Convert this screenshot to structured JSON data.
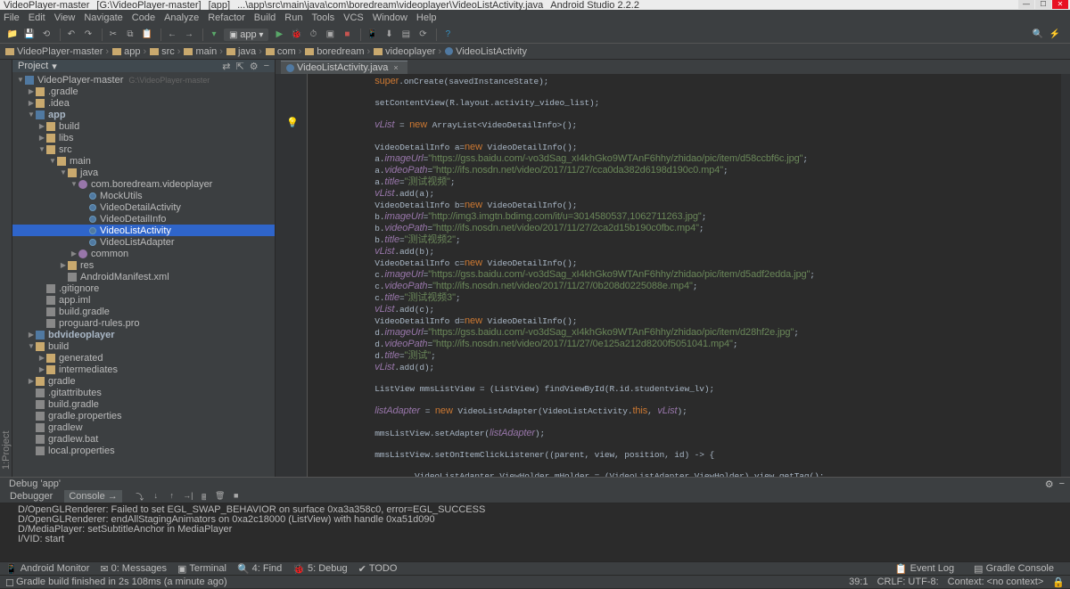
{
  "title": {
    "project": "VideoPlayer-master",
    "path": "[G:\\VideoPlayer-master]",
    "module": "[app]",
    "file": "...\\app\\src\\main\\java\\com\\boredream\\videoplayer\\VideoListActivity.java",
    "ide": "Android Studio 2.2.2"
  },
  "menu": [
    "File",
    "Edit",
    "View",
    "Navigate",
    "Code",
    "Analyze",
    "Refactor",
    "Build",
    "Run",
    "Tools",
    "VCS",
    "Window",
    "Help"
  ],
  "toolbar": {
    "config": "app"
  },
  "breadcrumb": [
    "VideoPlayer-master",
    "app",
    "src",
    "main",
    "java",
    "com",
    "boredream",
    "videoplayer",
    "VideoListActivity"
  ],
  "project_header": "Project",
  "tree": [
    {
      "d": 0,
      "a": "open",
      "i": "module",
      "l": "VideoPlayer-master",
      "p": "G:\\VideoPlayer-master"
    },
    {
      "d": 1,
      "a": "closed",
      "i": "folder",
      "l": ".gradle"
    },
    {
      "d": 1,
      "a": "closed",
      "i": "folder",
      "l": ".idea"
    },
    {
      "d": 1,
      "a": "open",
      "i": "module",
      "l": "app",
      "cls": "mod"
    },
    {
      "d": 2,
      "a": "closed",
      "i": "folder",
      "l": "build"
    },
    {
      "d": 2,
      "a": "closed",
      "i": "folder",
      "l": "libs"
    },
    {
      "d": 2,
      "a": "open",
      "i": "folder",
      "l": "src"
    },
    {
      "d": 3,
      "a": "open",
      "i": "folder",
      "l": "main"
    },
    {
      "d": 4,
      "a": "open",
      "i": "folder",
      "l": "java"
    },
    {
      "d": 5,
      "a": "open",
      "i": "pkg",
      "l": "com.boredream.videoplayer"
    },
    {
      "d": 6,
      "a": "none",
      "i": "class",
      "l": "MockUtils"
    },
    {
      "d": 6,
      "a": "none",
      "i": "class",
      "l": "VideoDetailActivity"
    },
    {
      "d": 6,
      "a": "none",
      "i": "class",
      "l": "VideoDetailInfo"
    },
    {
      "d": 6,
      "a": "none",
      "i": "class",
      "l": "VideoListActivity",
      "sel": true
    },
    {
      "d": 6,
      "a": "none",
      "i": "class",
      "l": "VideoListAdapter"
    },
    {
      "d": 5,
      "a": "closed",
      "i": "pkg",
      "l": "common"
    },
    {
      "d": 4,
      "a": "closed",
      "i": "folder",
      "l": "res"
    },
    {
      "d": 4,
      "a": "none",
      "i": "file",
      "l": "AndroidManifest.xml"
    },
    {
      "d": 2,
      "a": "none",
      "i": "file",
      "l": ".gitignore"
    },
    {
      "d": 2,
      "a": "none",
      "i": "file",
      "l": "app.iml"
    },
    {
      "d": 2,
      "a": "none",
      "i": "file",
      "l": "build.gradle"
    },
    {
      "d": 2,
      "a": "none",
      "i": "file",
      "l": "proguard-rules.pro"
    },
    {
      "d": 1,
      "a": "closed",
      "i": "module",
      "l": "bdvideoplayer",
      "cls": "mod"
    },
    {
      "d": 1,
      "a": "open",
      "i": "folder",
      "l": "build"
    },
    {
      "d": 2,
      "a": "closed",
      "i": "folder",
      "l": "generated"
    },
    {
      "d": 2,
      "a": "closed",
      "i": "folder",
      "l": "intermediates"
    },
    {
      "d": 1,
      "a": "closed",
      "i": "folder",
      "l": "gradle"
    },
    {
      "d": 1,
      "a": "none",
      "i": "file",
      "l": ".gitattributes"
    },
    {
      "d": 1,
      "a": "none",
      "i": "file",
      "l": "build.gradle"
    },
    {
      "d": 1,
      "a": "none",
      "i": "file",
      "l": "gradle.properties"
    },
    {
      "d": 1,
      "a": "none",
      "i": "file",
      "l": "gradlew"
    },
    {
      "d": 1,
      "a": "none",
      "i": "file",
      "l": "gradlew.bat"
    },
    {
      "d": 1,
      "a": "none",
      "i": "file",
      "l": "local.properties"
    }
  ],
  "file_tab": "VideoListActivity.java",
  "code": "            super.onCreate(savedInstanceState);\n\n            setContentView(R.layout.activity_video_list);\n\n            vList = new ArrayList<VideoDetailInfo>();\n\n            VideoDetailInfo a=new VideoDetailInfo();\n            a.imageUrl=\"https://gss.baidu.com/-vo3dSag_xI4khGko9WTAnF6hhy/zhidao/pic/item/d58ccbf6c.jpg\";\n            a.videoPath=\"http://ifs.nosdn.net/video/2017/11/27/cca0da382d6198d190c0.mp4\";\n            a.title=\"测试视频\";\n            vList.add(a);\n            VideoDetailInfo b=new VideoDetailInfo();\n            b.imageUrl=\"http://img3.imgtn.bdimg.com/it/u=3014580537,1062711263.jpg\";\n            b.videoPath=\"http://ifs.nosdn.net/video/2017/11/27/2ca2d15b190c0fbc.mp4\";\n            b.title=\"测试视频2\";\n            vList.add(b);\n            VideoDetailInfo c=new VideoDetailInfo();\n            c.imageUrl=\"https://gss.baidu.com/-vo3dSag_xI4khGko9WTAnF6hhy/zhidao/pic/item/d5adf2edda.jpg\";\n            c.videoPath=\"http://ifs.nosdn.net/video/2017/11/27/0b208d0225088e.mp4\";\n            c.title=\"测试视频3\";\n            vList.add(c);\n            VideoDetailInfo d=new VideoDetailInfo();\n            d.imageUrl=\"https://gss.baidu.com/-vo3dSag_xI4khGko9WTAnF6hhy/zhidao/pic/item/d28hf2e.jpg\";\n            d.videoPath=\"http://ifs.nosdn.net/video/2017/11/27/0e125a212d8200f5051041.mp4\";\n            d.title=\"测试\";\n            vList.add(d);\n\n            ListView mmsListView = (ListView) findViewById(R.id.studentview_lv);\n\n            listAdapter = new VideoListAdapter(VideoListActivity.this, vList);\n\n            mmsListView.setAdapter(listAdapter);\n\n            mmsListView.setOnItemClickListener((parent, view, position, id) -> {\n\n                    VideoListAdapter.ViewHolder mHolder = (VideoListAdapter.ViewHolder) view.getTag();\n\n                    // videoView.setControc()",
  "debug_title": "Debug 'app'",
  "debugger": "Debugger",
  "console_tab": "Console",
  "console": [
    "D/OpenGLRenderer: Failed to set EGL_SWAP_BEHAVIOR on surface 0xa3a358c0, error=EGL_SUCCESS",
    "D/OpenGLRenderer: endAllStagingAnimators on 0xa2c18000 (ListView) with handle 0xa51d090",
    "D/MediaPlayer: setSubtitleAnchor in MediaPlayer",
    "I/VID: start"
  ],
  "bottom_tools": {
    "monitor": "Android Monitor",
    "messages": "0: Messages",
    "terminal": "Terminal",
    "find": "4: Find",
    "debug": "5: Debug",
    "todo": "TODO",
    "eventlog": "Event Log",
    "gradleconsole": "Gradle Console"
  },
  "status": {
    "msg": "Gradle build finished in 2s 108ms (a minute ago)",
    "pos": "39:1",
    "encoding": "CRLF: UTF-8:",
    "context": "Context: <no context>"
  }
}
